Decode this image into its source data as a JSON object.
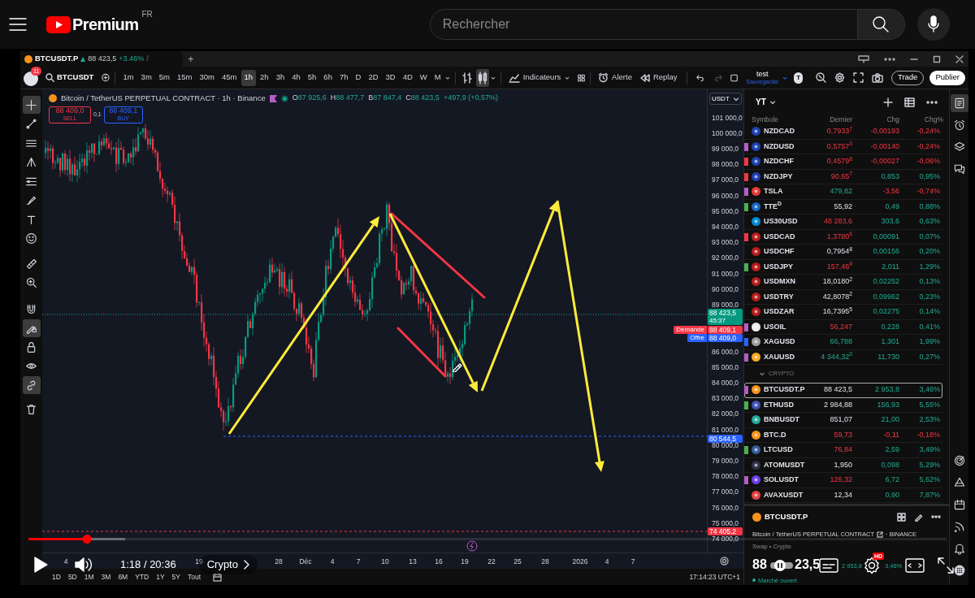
{
  "youtube": {
    "logo_text": "Premium",
    "region": "FR",
    "search": {
      "placeholder": "Rechercher"
    }
  },
  "tab": {
    "symbol": "BTCUSDT.P",
    "price": "88 423,5",
    "change": "+3.46%",
    "separator": "/",
    "new_tab": "+"
  },
  "toolbar": {
    "notifications": "11",
    "symbol": "BTCUSDT",
    "intervals": [
      {
        "label": "1m",
        "selected": false
      },
      {
        "label": "3m",
        "selected": false
      },
      {
        "label": "5m",
        "selected": false
      },
      {
        "label": "15m",
        "selected": false
      },
      {
        "label": "30m",
        "selected": false
      },
      {
        "label": "45m",
        "selected": false
      },
      {
        "label": "1h",
        "selected": true
      },
      {
        "label": "2h",
        "selected": false
      },
      {
        "label": "3h",
        "selected": false
      },
      {
        "label": "4h",
        "selected": false
      },
      {
        "label": "5h",
        "selected": false
      },
      {
        "label": "6h",
        "selected": false
      },
      {
        "label": "7h",
        "selected": false
      },
      {
        "label": "D",
        "selected": false
      },
      {
        "label": "2D",
        "selected": false
      },
      {
        "label": "3D",
        "selected": false
      },
      {
        "label": "4D",
        "selected": false
      },
      {
        "label": "W",
        "selected": false
      },
      {
        "label": "M",
        "selected": false
      }
    ],
    "chart_types": [
      {
        "kind": "bars",
        "selected": false
      },
      {
        "kind": "candles",
        "selected": true
      }
    ],
    "indicators": "Indicateurs",
    "alert": "Alerte",
    "replay": "Replay",
    "layout_name": "test",
    "layout_status": "Sauvegarder",
    "user_initial": "T",
    "trade": "Trade",
    "publish": "Publier"
  },
  "tools": [
    {
      "kind": "cursor",
      "selected": true
    },
    {
      "kind": "trend",
      "selected": false
    },
    {
      "kind": "hlines",
      "selected": false
    },
    {
      "kind": "pitchfork",
      "selected": false
    },
    {
      "kind": "fib",
      "selected": false
    },
    {
      "kind": "brush",
      "selected": false
    },
    {
      "kind": "text",
      "selected": false
    },
    {
      "kind": "emoji",
      "selected": false
    },
    {
      "kind": "ruler",
      "selected": false
    },
    {
      "kind": "zoom",
      "selected": false
    },
    {
      "kind": "magnet",
      "selected": false
    },
    {
      "kind": "lockdraw",
      "selected": true
    },
    {
      "kind": "lock",
      "selected": false
    },
    {
      "kind": "eye",
      "selected": false
    },
    {
      "kind": "link",
      "selected": true
    },
    {
      "kind": "trash",
      "selected": false
    }
  ],
  "chart": {
    "title": "Bitcoin / TetherUS PERPETUAL CONTRACT · 1h · Binance",
    "ohlc": [
      {
        "label": "O",
        "value": "87 925,6"
      },
      {
        "label": "H",
        "value": "88 477,7"
      },
      {
        "label": "B",
        "value": "87 847,4"
      },
      {
        "label": "C",
        "value": "88 423,5"
      }
    ],
    "change": "+497,9 (+0,57%)",
    "sell": {
      "price": "88 409,0",
      "label": "SELL"
    },
    "spread": "0,1",
    "buy": {
      "price": "88 409,1",
      "label": "BUY"
    }
  },
  "price_axis": {
    "currency": "USDT",
    "ticks": [
      "101 000,0",
      "100 000,0",
      "99 000,0",
      "98 000,0",
      "97 000,0",
      "96 000,0",
      "95 000,0",
      "94 000,0",
      "93 000,0",
      "92 000,0",
      "91 000,0",
      "90 000,0",
      "89 000,0",
      "86 000,0",
      "85 000,0",
      "84 000,0",
      "83 000,0",
      "82 000,0",
      "81 000,0",
      "80 000,0",
      "79 000,0",
      "78 000,0",
      "77 000,0",
      "76 000,0",
      "75 000,0",
      "74 000,0"
    ],
    "badges": [
      {
        "value": "88 423,5",
        "sub": "45:37",
        "color": "#089981"
      },
      {
        "caption": "Demande",
        "value": "88 409,1",
        "color": "#f23645"
      },
      {
        "caption": "Offre",
        "value": "88 409,0",
        "color": "#2962ff"
      },
      {
        "value": "80 544,5",
        "color": "#2962ff"
      },
      {
        "value": "74 405,2",
        "color": "#f23645"
      }
    ]
  },
  "time_axis": {
    "labels": [
      "4",
      "19",
      "28",
      "Déc",
      "4",
      "7",
      "10",
      "13",
      "16",
      "19",
      "22",
      "25",
      "28",
      "2026",
      "4",
      "7"
    ]
  },
  "ranges": [
    "1D",
    "5D",
    "1M",
    "3M",
    "6M",
    "YTD",
    "1Y",
    "5Y",
    "Tout"
  ],
  "clock": "17:14:23 UTC+1",
  "watchlist": {
    "name": "YT",
    "columns": [
      "Symbole",
      "Dernier",
      "Chg",
      "Chg%"
    ],
    "rows": [
      {
        "kind": "symbol",
        "symbol": "NZDCAD",
        "last": "0,7933$^{7}$",
        "chg": "-0,00193",
        "pct": "-0,24%",
        "tick_up": false,
        "negative": true,
        "selected": false
      },
      {
        "kind": "symbol",
        "symbol": "NZDUSD",
        "last": "0,5757$^{3}$",
        "chg": "-0,00140",
        "pct": "-0,24%",
        "tick_up": false,
        "negative": true,
        "selected": false,
        "color": "#b45dc5"
      },
      {
        "kind": "symbol",
        "symbol": "NZDCHF",
        "last": "0,4579$^{8}$",
        "chg": "-0,00027",
        "pct": "-0,06%",
        "tick_up": false,
        "negative": true,
        "selected": false,
        "color": "#f23645"
      },
      {
        "kind": "symbol",
        "symbol": "NZDJPY",
        "last": "90,65$^{7}$",
        "chg": "0,853",
        "pct": "0,95%",
        "tick_up": false,
        "negative": false,
        "selected": false,
        "color": "#f23645"
      },
      {
        "kind": "symbol",
        "symbol": "TSLA",
        "last": "479,82",
        "chg": "-3,56",
        "pct": "-0,74%",
        "tick_up": true,
        "negative": true,
        "selected": false,
        "color": "#b45dc5"
      },
      {
        "kind": "symbol",
        "symbol": "TTE$^{D}$",
        "last": "55,92",
        "chg": "0,49",
        "pct": "0,88%",
        "negative": false,
        "selected": false,
        "color": "#4caf50"
      },
      {
        "kind": "symbol",
        "symbol": "US30USD",
        "last": "48 283,6",
        "chg": "303,6",
        "pct": "0,63%",
        "tick_up": false,
        "negative": false,
        "selected": false
      },
      {
        "kind": "symbol",
        "symbol": "USDCAD",
        "last": "1,3780$^{6}$",
        "chg": "0,00091",
        "pct": "0,07%",
        "tick_up": false,
        "negative": false,
        "selected": false,
        "color": "#f23645"
      },
      {
        "kind": "symbol",
        "symbol": "USDCHF",
        "last": "0,7954$^{8}$",
        "chg": "0,00156",
        "pct": "0,20%",
        "negative": false,
        "selected": false
      },
      {
        "kind": "symbol",
        "symbol": "USDJPY",
        "last": "157,46$^{8}$",
        "chg": "2,011",
        "pct": "1,29%",
        "tick_up": false,
        "negative": false,
        "selected": false,
        "color": "#4caf50"
      },
      {
        "kind": "symbol",
        "symbol": "USDMXN",
        "last": "18,0180$^{2}$",
        "chg": "0,02252",
        "pct": "0,13%",
        "negative": false,
        "selected": false
      },
      {
        "kind": "symbol",
        "symbol": "USDTRY",
        "last": "42,8078$^{2}$",
        "chg": "0,09962",
        "pct": "0,23%",
        "negative": false,
        "selected": false
      },
      {
        "kind": "symbol",
        "symbol": "USDZAR",
        "last": "16,7395$^{5}$",
        "chg": "0,02275",
        "pct": "0,14%",
        "negative": false,
        "selected": false
      },
      {
        "kind": "symbol",
        "symbol": "USOIL",
        "last": "56,247",
        "chg": "0,228",
        "pct": "0,41%",
        "tick_up": false,
        "negative": false,
        "selected": false,
        "color": "#b45dc5"
      },
      {
        "kind": "symbol",
        "symbol": "XAGUSD",
        "last": "66,788",
        "chg": "1,301",
        "pct": "1,99%",
        "tick_up": true,
        "negative": false,
        "selected": false,
        "color": "#2962ff"
      },
      {
        "kind": "symbol",
        "symbol": "XAUUSD",
        "last": "4 344,32$^{0}$",
        "chg": "11,730",
        "pct": "0,27%",
        "tick_up": true,
        "negative": false,
        "selected": false,
        "color": "#b45dc5"
      },
      {
        "kind": "section",
        "label": "CRYPTO",
        "expanded": true
      },
      {
        "kind": "symbol",
        "symbol": "BTCUSDT.P",
        "last": "88 423,5",
        "chg": "2 953,8",
        "pct": "3,46%",
        "negative": false,
        "selected": true,
        "color": "#b45dc5"
      },
      {
        "kind": "symbol",
        "symbol": "ETHUSD",
        "last": "2 984,88",
        "chg": "156,93",
        "pct": "5,55%",
        "negative": false,
        "selected": false,
        "color": "#4caf50"
      },
      {
        "kind": "symbol",
        "symbol": "BNBUSDT",
        "last": "851,07",
        "chg": "21,00",
        "pct": "2,53%",
        "negative": false,
        "selected": false
      },
      {
        "kind": "symbol",
        "symbol": "BTC.D",
        "last": "59,73",
        "chg": "-0,11",
        "pct": "-0,18%",
        "tick_up": false,
        "negative": true,
        "selected": false
      },
      {
        "kind": "symbol",
        "symbol": "LTCUSD",
        "last": "76,84",
        "chg": "2,59",
        "pct": "3,49%",
        "tick_up": false,
        "negative": false,
        "selected": false,
        "color": "#4caf50"
      },
      {
        "kind": "symbol",
        "symbol": "ATOMUSDT",
        "last": "1,950",
        "chg": "0,098",
        "pct": "5,29%",
        "negative": false,
        "selected": false
      },
      {
        "kind": "symbol",
        "symbol": "SOLUSDT",
        "last": "126,32",
        "chg": "6,72",
        "pct": "5,62%",
        "tick_up": false,
        "negative": false,
        "selected": false,
        "color": "#b45dc5"
      },
      {
        "kind": "symbol",
        "symbol": "AVAXUSDT",
        "last": "12,34",
        "chg": "0,90",
        "pct": "7,87%",
        "negative": false,
        "selected": false
      }
    ]
  },
  "detail": {
    "symbol": "BTCUSDT.P",
    "description": "Bitcoin / TetherUS PERPETUAL CONTRACT",
    "exchange": "· BINANCE",
    "category": "Swap • Crypto",
    "price_parts": [
      "88",
      "23,5"
    ],
    "change": "2 953,8",
    "pct": "3,46%",
    "market": "Marché ouvert"
  },
  "side_icons": [
    {
      "kind": "watchlist",
      "selected": true
    },
    {
      "kind": "alarm",
      "selected": false
    },
    {
      "kind": "layers",
      "selected": false
    },
    {
      "kind": "chat",
      "selected": false
    },
    {
      "kind": "target",
      "selected": false
    },
    {
      "kind": "shapes",
      "selected": false
    },
    {
      "kind": "calendar",
      "selected": false
    },
    {
      "kind": "broadcast",
      "selected": false
    },
    {
      "kind": "bell",
      "selected": false
    },
    {
      "kind": "apps",
      "selected": false
    }
  ],
  "player": {
    "level": 0.064,
    "time": "1:18 / 20:36",
    "chapter": "Crypto",
    "quality": "HD"
  }
}
